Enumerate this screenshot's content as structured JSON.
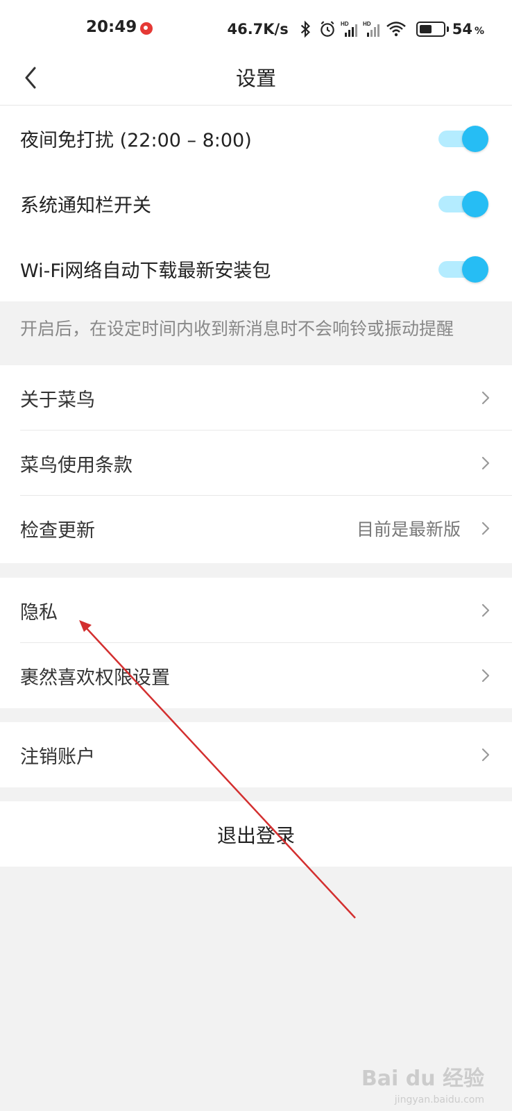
{
  "status_bar": {
    "time": "20:49",
    "net_speed": "46.7K/s",
    "battery_level": "54",
    "battery_unit": "%",
    "battery_fraction": 0.54,
    "icons": [
      "bluetooth-icon",
      "alarm-icon",
      "signal-hd-icon",
      "signal-hd-icon",
      "wifi-icon",
      "battery-icon"
    ]
  },
  "nav": {
    "title": "设置"
  },
  "toggles": [
    {
      "label": "夜间免打扰 (22:00 – 8:00)",
      "on": true
    },
    {
      "label": "系统通知栏开关",
      "on": true
    },
    {
      "label": "Wi-Fi网络自动下载最新安装包",
      "on": true
    }
  ],
  "hint": "开启后，在设定时间内收到新消息时不会响铃或振动提醒",
  "about_group": [
    {
      "label": "关于菜鸟",
      "value": ""
    },
    {
      "label": "菜鸟使用条款",
      "value": ""
    },
    {
      "label": "检查更新",
      "value": "目前是最新版"
    }
  ],
  "privacy_group": [
    {
      "label": "隐私"
    },
    {
      "label": "裹然喜欢权限设置"
    }
  ],
  "account_group": [
    {
      "label": "注销账户"
    }
  ],
  "logout": {
    "label": "退出登录"
  },
  "watermark": {
    "brand": "Bai du 经验",
    "url": "jingyan.baidu.com"
  },
  "colors": {
    "accent": "#26bdf4",
    "toggle_track": "#b4ecff",
    "background": "#f2f2f2",
    "annotation_arrow": "#d32f2f"
  }
}
